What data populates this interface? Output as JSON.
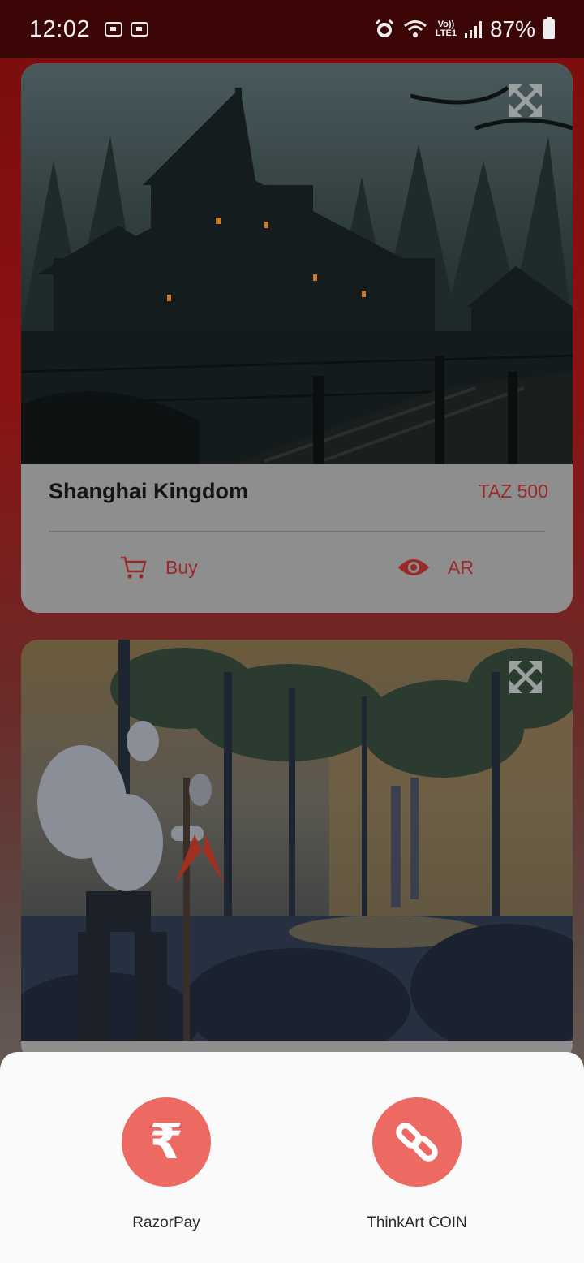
{
  "status_bar": {
    "time": "12:02",
    "network_label_top": "Vo))",
    "network_label_bottom": "LTE1",
    "battery": "87%"
  },
  "artworks": [
    {
      "title": "Shanghai Kingdom",
      "price": "TAZ 500",
      "buy_label": "Buy",
      "ar_label": "AR",
      "image": "dark-lake-palace-forest-artwork"
    },
    {
      "image": "forest-warrior-ruins-artwork"
    }
  ],
  "payment_sheet": {
    "options": [
      {
        "label": "RazorPay",
        "icon": "rupee-icon",
        "glyph": "₹"
      },
      {
        "label": "ThinkArt COIN",
        "icon": "link-icon"
      }
    ],
    "accent": "#ec6a62"
  }
}
